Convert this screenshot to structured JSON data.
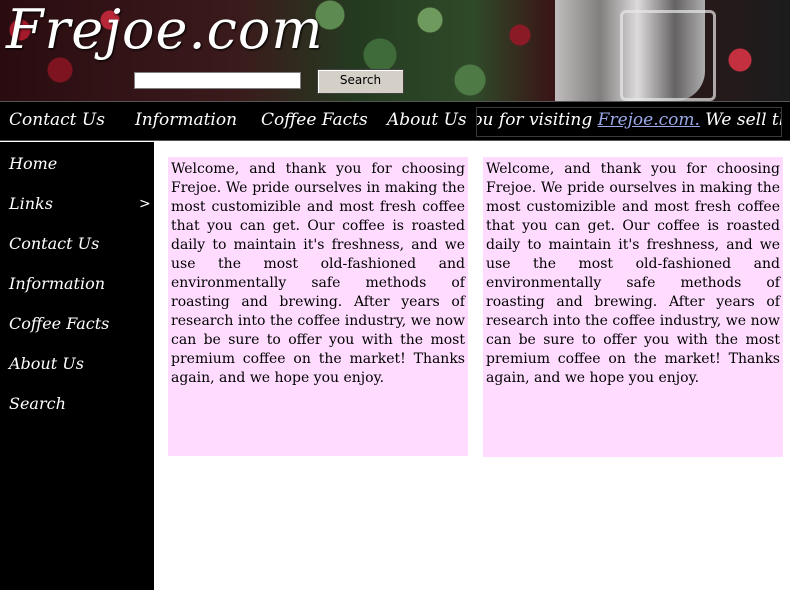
{
  "header": {
    "logo_text": "Frejoe.com",
    "search": {
      "value": "",
      "placeholder": "",
      "button_label": "Search"
    }
  },
  "topnav": {
    "items": [
      "Contact Us",
      "Information",
      "Coffee Facts",
      "About Us"
    ],
    "marquee": {
      "prefix": "k you for visiting ",
      "site": "Frejoe.com.",
      "suffix": " We sell the"
    }
  },
  "sidebar": {
    "items": [
      "Home",
      "Links",
      "Contact Us",
      "Information",
      "Coffee Facts",
      "About Us",
      "Search"
    ],
    "submenu_arrow": ">"
  },
  "content": {
    "panels": [
      {
        "text": "Welcome, and thank you for choosing Frejoe. We pride ourselves in making the most customizible and most fresh coffee that you can get. Our coffee is roasted daily to maintain it's freshness, and we use the most old-fashioned and environmentally safe methods of roasting and brewing. After years of research into the coffee industry, we now can be sure to offer you with the most premium coffee on the market! Thanks again, and we hope you enjoy."
      },
      {
        "text": "Welcome, and thank you for choosing Frejoe. We pride ourselves in making the most customizible and most fresh coffee that you can get. Our coffee is roasted daily to maintain it's freshness, and we use the most old-fashioned and environmentally safe methods of roasting and brewing. After years of research into the coffee industry, we now can be sure to offer you with the most premium coffee on the market! Thanks again, and we hope you enjoy."
      }
    ]
  },
  "colors": {
    "panel_bg": "#ffdcff",
    "nav_bg": "#000000",
    "link_accent": "#9aa8e8"
  }
}
